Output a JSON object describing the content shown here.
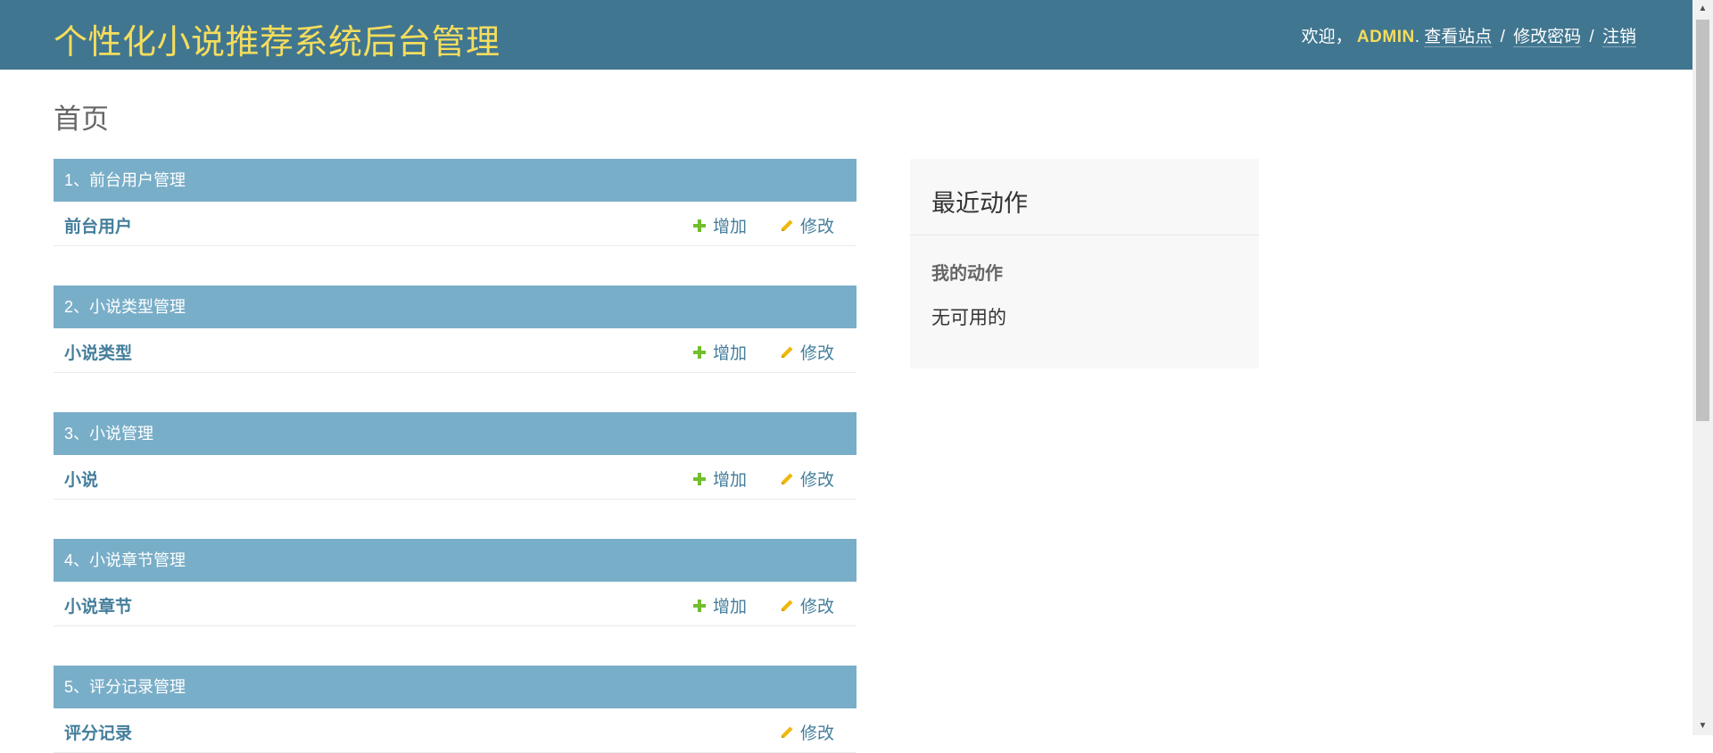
{
  "header": {
    "branding": "个性化小说推荐系统后台管理",
    "welcome": "欢迎，",
    "username": "ADMIN",
    "after_username": ".",
    "view_site": "查看站点",
    "change_password": "修改密码",
    "logout": "注销",
    "separator": "/"
  },
  "page_title": "首页",
  "modules": [
    {
      "caption": "1、前台用户管理",
      "model": "前台用户",
      "add": "增加",
      "change": "修改"
    },
    {
      "caption": "2、小说类型管理",
      "model": "小说类型",
      "add": "增加",
      "change": "修改"
    },
    {
      "caption": "3、小说管理",
      "model": "小说",
      "add": "增加",
      "change": "修改"
    },
    {
      "caption": "4、小说章节管理",
      "model": "小说章节",
      "add": "增加",
      "change": "修改"
    },
    {
      "caption": "5、评分记录管理",
      "model": "评分记录",
      "change": "修改"
    }
  ],
  "recent_actions": {
    "title": "最近动作",
    "subtitle": "我的动作",
    "empty": "无可用的"
  },
  "colors": {
    "header_bg": "#417690",
    "branding": "#f5dd5d",
    "caption_bg": "#79aec8",
    "link": "#447e9b",
    "add_icon": "#70bf2b",
    "change_icon": "#efb80b"
  },
  "icons": {
    "add": "plus-icon",
    "change": "pencil-icon"
  }
}
